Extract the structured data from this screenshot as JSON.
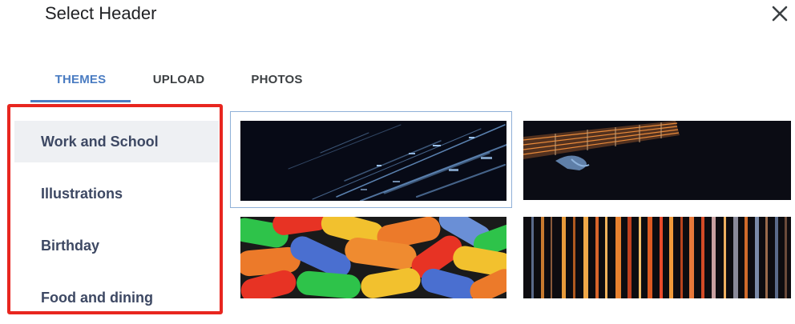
{
  "dialog": {
    "title": "Select Header",
    "close_icon": "close-icon"
  },
  "tabs": [
    {
      "label": "THEMES",
      "active": true
    },
    {
      "label": "UPLOAD",
      "active": false
    },
    {
      "label": "PHOTOS",
      "active": false
    }
  ],
  "categories": [
    {
      "label": "Work and School",
      "selected": true
    },
    {
      "label": "Illustrations",
      "selected": false
    },
    {
      "label": "Birthday",
      "selected": false
    },
    {
      "label": "Food and dining",
      "selected": false
    }
  ],
  "thumbnails": [
    {
      "subject": "blue light streaks on dark background",
      "selected": true
    },
    {
      "subject": "guitar neck with orange strings",
      "selected": false
    },
    {
      "subject": "colorful capsule pills",
      "selected": false
    },
    {
      "subject": "orange vertical light stripes",
      "selected": false
    }
  ],
  "colors": {
    "accent": "#4a7cc2",
    "highlight_box": "#e8261f",
    "category_text": "#3d4863"
  }
}
